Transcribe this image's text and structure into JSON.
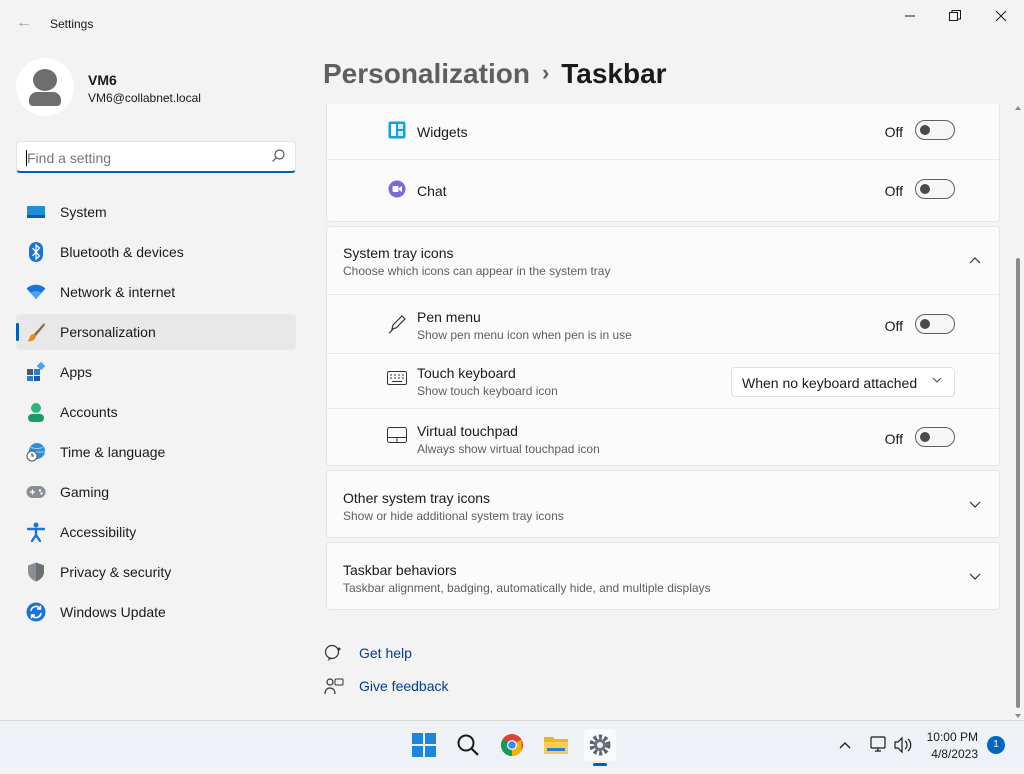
{
  "app": {
    "title": "Settings"
  },
  "profile": {
    "name": "VM6",
    "email": "VM6@collabnet.local"
  },
  "search": {
    "placeholder": "Find a setting"
  },
  "nav": {
    "items": [
      {
        "label": "System",
        "icon": "system-icon"
      },
      {
        "label": "Bluetooth & devices",
        "icon": "bluetooth-icon"
      },
      {
        "label": "Network & internet",
        "icon": "wifi-icon"
      },
      {
        "label": "Personalization",
        "icon": "brush-icon",
        "selected": true
      },
      {
        "label": "Apps",
        "icon": "apps-icon"
      },
      {
        "label": "Accounts",
        "icon": "accounts-icon"
      },
      {
        "label": "Time & language",
        "icon": "globe-clock-icon"
      },
      {
        "label": "Gaming",
        "icon": "gamepad-icon"
      },
      {
        "label": "Accessibility",
        "icon": "accessibility-icon"
      },
      {
        "label": "Privacy & security",
        "icon": "shield-icon"
      },
      {
        "label": "Windows Update",
        "icon": "update-icon"
      }
    ]
  },
  "header": {
    "crumb": "Personalization",
    "separator": "›",
    "title": "Taskbar"
  },
  "taskbar_items": {
    "widgets": {
      "label": "Widgets",
      "state": "Off"
    },
    "chat": {
      "label": "Chat",
      "state": "Off"
    }
  },
  "system_tray": {
    "title": "System tray icons",
    "subtitle": "Choose which icons can appear in the system tray",
    "pen": {
      "title": "Pen menu",
      "subtitle": "Show pen menu icon when pen is in use",
      "state": "Off"
    },
    "keyboard": {
      "title": "Touch keyboard",
      "subtitle": "Show touch keyboard icon",
      "selected": "When no keyboard attached"
    },
    "touchpad": {
      "title": "Virtual touchpad",
      "subtitle": "Always show virtual touchpad icon",
      "state": "Off"
    }
  },
  "other_tray": {
    "title": "Other system tray icons",
    "subtitle": "Show or hide additional system tray icons"
  },
  "behaviors": {
    "title": "Taskbar behaviors",
    "subtitle": "Taskbar alignment, badging, automatically hide, and multiple displays"
  },
  "links": {
    "help": "Get help",
    "feedback": "Give feedback"
  },
  "clock": {
    "time": "10:00 PM",
    "date": "4/8/2023"
  },
  "notifications": {
    "count": "1"
  },
  "colors": {
    "accent": "#005fb8",
    "link": "#003e92"
  }
}
